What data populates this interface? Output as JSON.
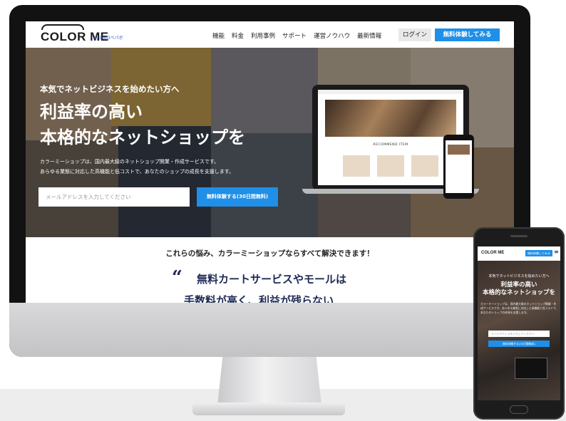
{
  "header": {
    "logo": "COLOR ME",
    "logo_sub": "by GMOペパボ",
    "nav": [
      "機能",
      "料金",
      "利用事例",
      "サポート",
      "運営ノウハウ",
      "最新情報"
    ],
    "login": "ログイン",
    "trial": "無料体験してみる"
  },
  "hero": {
    "subtitle": "本気でネットビジネスを始めたい方へ",
    "headline_1": "利益率の高い",
    "headline_2": "本格的なネットショップを",
    "desc_1": "カラーミーショップは、国内最大級のネットショップ開業・作成サービスです。",
    "desc_2": "あらゆる業態に対応した高機能と低コストで、あなたのショップの成長を支援します。",
    "email_placeholder": "メールアドレスを入力してください",
    "cta": "無料体験する(30日間無料)",
    "laptop_caption": "RECOMMEND ITEM"
  },
  "section": {
    "title": "これらの悩み、カラーミーショップならすべて解決できます！",
    "quote_mark": "“",
    "quote_line_1": "無料カートサービスやモールは",
    "quote_line_2": "手数料が高く、利益が残らない"
  },
  "mobile": {
    "logo": "COLOR ME",
    "trial": "無料体験してみる",
    "menu": "≡",
    "subtitle": "本気でネットビジネスを始めたい方へ",
    "headline_1": "利益率の高い",
    "headline_2": "本格的なネットショップを",
    "desc": "カラーミーショップは、国内最大級のネットショップ開業・作成サービスです。あらゆる業態に対応した高機能と低コストで、あなたのショップの成長を支援します。",
    "email_placeholder": "メールアドレスを入力してください",
    "cta": "無料体験する(30日間無料)"
  },
  "colors": {
    "accent": "#1f8fe8",
    "navy": "#1e2a55"
  }
}
